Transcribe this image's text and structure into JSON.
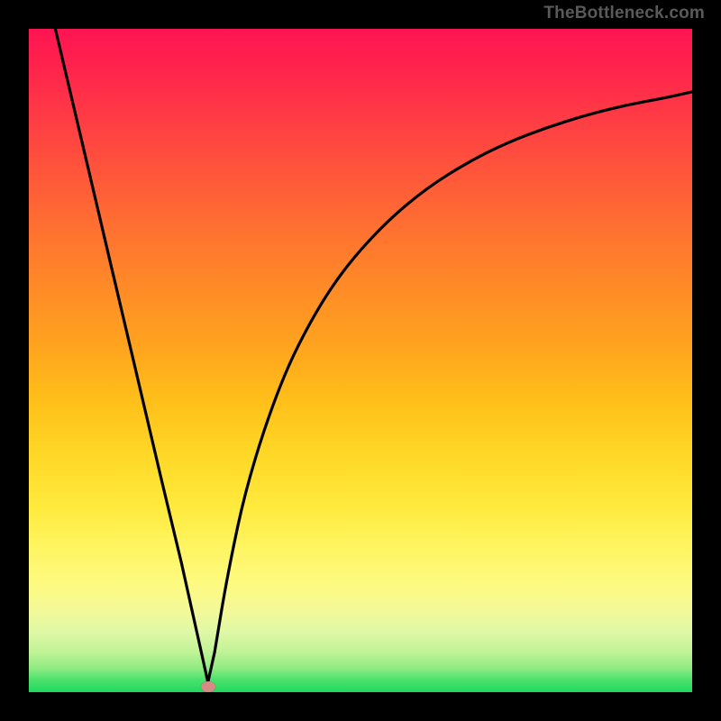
{
  "watermark": "TheBottleneck.com",
  "chart_data": {
    "type": "line",
    "title": "",
    "xlabel": "",
    "ylabel": "",
    "xlim": [
      0,
      1
    ],
    "ylim": [
      0,
      1
    ],
    "grid": false,
    "series": [
      {
        "name": "curve",
        "x": [
          0.04,
          0.08,
          0.12,
          0.16,
          0.2,
          0.23,
          0.26,
          0.27,
          0.28,
          0.3,
          0.33,
          0.38,
          0.43,
          0.48,
          0.54,
          0.6,
          0.66,
          0.72,
          0.78,
          0.84,
          0.9,
          0.96,
          1.0
        ],
        "values": [
          1.0,
          0.83,
          0.66,
          0.49,
          0.32,
          0.195,
          0.06,
          0.015,
          0.06,
          0.18,
          0.32,
          0.47,
          0.57,
          0.645,
          0.71,
          0.76,
          0.798,
          0.828,
          0.851,
          0.87,
          0.885,
          0.896,
          0.905
        ]
      }
    ],
    "marker": {
      "x": 0.27,
      "y": 0.008
    },
    "gradient": {
      "top": "#ff1452",
      "mid1": "#ff8828",
      "mid2": "#ffd726",
      "mid3": "#fdfa82",
      "bottom": "#1fd95f"
    }
  }
}
